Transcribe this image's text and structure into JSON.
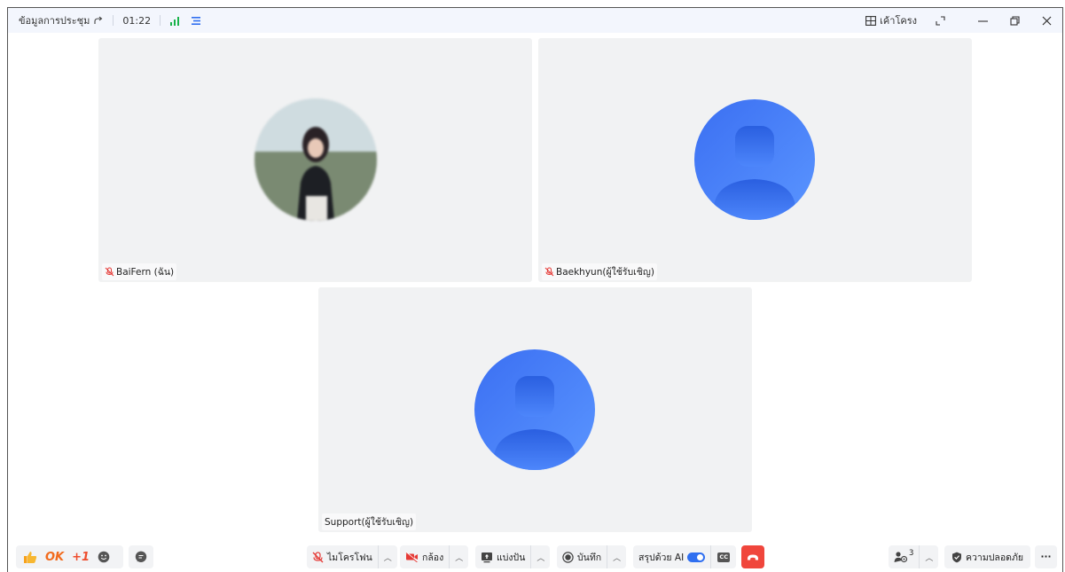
{
  "titlebar": {
    "meeting_info": "ข้อมูลการประชุม",
    "timer": "01:22",
    "layout_label": "เค้าโครง"
  },
  "participants": [
    {
      "name": "BaiFern (ฉัน)",
      "muted": true,
      "avatar": "photo"
    },
    {
      "name": "Baekhyun(ผู้ใช้รับเชิญ)",
      "muted": true,
      "avatar": "default"
    },
    {
      "name": "Support(ผู้ใช้รับเชิญ)",
      "muted": false,
      "avatar": "default"
    }
  ],
  "toolbar": {
    "reactions": {
      "ok": "OK",
      "plus_one": "+1"
    },
    "mic_label": "ไมโครโฟน",
    "camera_label": "กล้อง",
    "share_label": "แบ่งปัน",
    "record_label": "บันทึก",
    "ai_summary_label": "สรุปด้วย AI",
    "cc_label": "CC",
    "participants_count": "3",
    "security_label": "ความปลอดภัย",
    "more_label": "···"
  },
  "colors": {
    "accent": "#2f6ff0",
    "end_call": "#f0463c",
    "muted_red": "#e53935",
    "signal_green": "#19b34a",
    "reaction_orange": "#f26b1d"
  }
}
